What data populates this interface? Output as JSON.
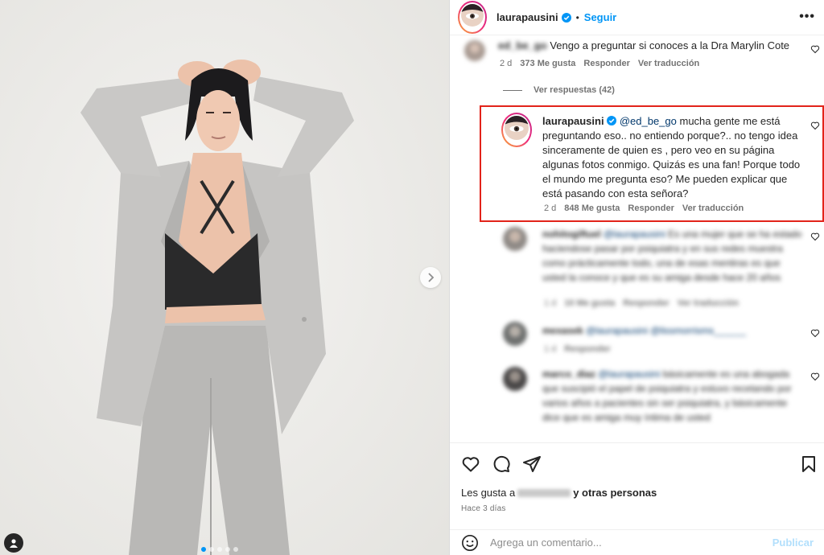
{
  "post": {
    "author": "laurapausini",
    "follow_label": "Seguir",
    "more_label": "•••"
  },
  "comments": [
    {
      "user": "ed_be_go",
      "text": "Vengo a preguntar si conoces a la Dra Marylin Cote",
      "age": "2 d",
      "likes": "373 Me gusta",
      "reply": "Responder",
      "translate": "Ver traducción",
      "view_replies": "Ver respuestas (42)"
    },
    {
      "user": "laurapausini",
      "mention": "@ed_be_go",
      "text": " mucha gente me está preguntando eso.. no entiendo porque?.. no tengo idea sinceramente de quien es , pero veo en su página algunas fotos conmigo. Quizás es una fan! Porque todo el mundo me pregunta eso? Me pueden explicar que está pasando con esta señora?",
      "age": "2 d",
      "likes": "848 Me gusta",
      "reply": "Responder",
      "translate": "Ver traducción"
    },
    {
      "user": "nohitogiftuel",
      "mention": "@laurapausini",
      "text": " Es una mujer que se ha estado haciendose pasar por psiquiatra y en sus redes muestra como prácticamente todo, una de esas mentiras es que usted la conoce y que es su amiga desde hace 20 años",
      "age": "1 d",
      "likes": "10 Me gusta",
      "reply": "Responder",
      "translate": "Ver traducción"
    },
    {
      "user": "mexasek",
      "mention": "@laurapausini @lissmorrisms______",
      "text": "",
      "age": "1 d",
      "reply": "Responder"
    },
    {
      "user": "marco_diaz",
      "mention": "@laurapausini",
      "text": " básicamente es una abogada que suscipió el papel de psiquiatra y estuvo recetando por varios años a pacientes sin ser psiquiatra, y básicamente dice que es amiga muy íntima de usted"
    }
  ],
  "actions": {
    "icons": [
      "heart-icon",
      "comment-icon",
      "share-icon",
      "save-icon"
    ],
    "likes_prefix": "Les gusta a",
    "likes_suffix": "y otras personas",
    "date": "Hace 3 días"
  },
  "composer": {
    "placeholder": "Agrega un comentario...",
    "publish": "Publicar"
  },
  "colors": {
    "accent": "#0095f6",
    "highlight_border": "#e2231a",
    "muted_text": "#737373"
  }
}
